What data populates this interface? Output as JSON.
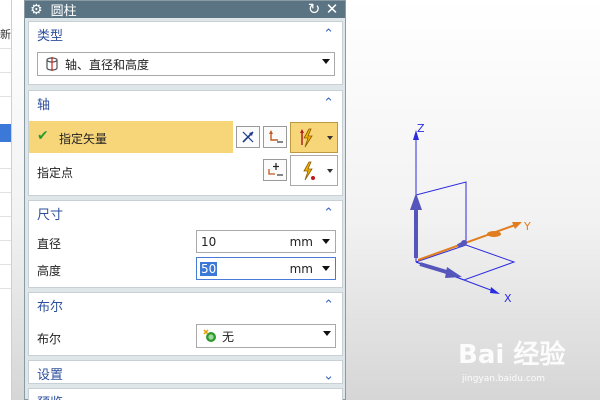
{
  "left_strip": {
    "label": "新"
  },
  "dialog": {
    "title": "圆柱",
    "sections": {
      "type": {
        "header": "类型",
        "selected": "轴、直径和高度"
      },
      "axis": {
        "header": "轴",
        "specify_vector": "指定矢量",
        "specify_point": "指定点"
      },
      "dimensions": {
        "header": "尺寸",
        "diameter_label": "直径",
        "diameter_value": "10",
        "diameter_unit": "mm",
        "height_label": "高度",
        "height_value": "50",
        "height_unit": "mm"
      },
      "boolean": {
        "header": "布尔",
        "label": "布尔",
        "value": "无"
      },
      "settings": {
        "header": "设置"
      },
      "preview": {
        "header": "预览"
      }
    }
  },
  "viewport": {
    "axis_z": "Z",
    "axis_y": "Y",
    "axis_x": "X",
    "watermark": "Bai 经验",
    "watermark_url": "jingyan.baidu.com"
  },
  "colors": {
    "titlebar": "#5a7483",
    "section_header_text": "#2d4f9b",
    "highlight_row": "#f7d67a",
    "axis_z": "#3a3aa8",
    "axis_x": "#3a3aa8",
    "axis_y": "#e07d1e"
  }
}
